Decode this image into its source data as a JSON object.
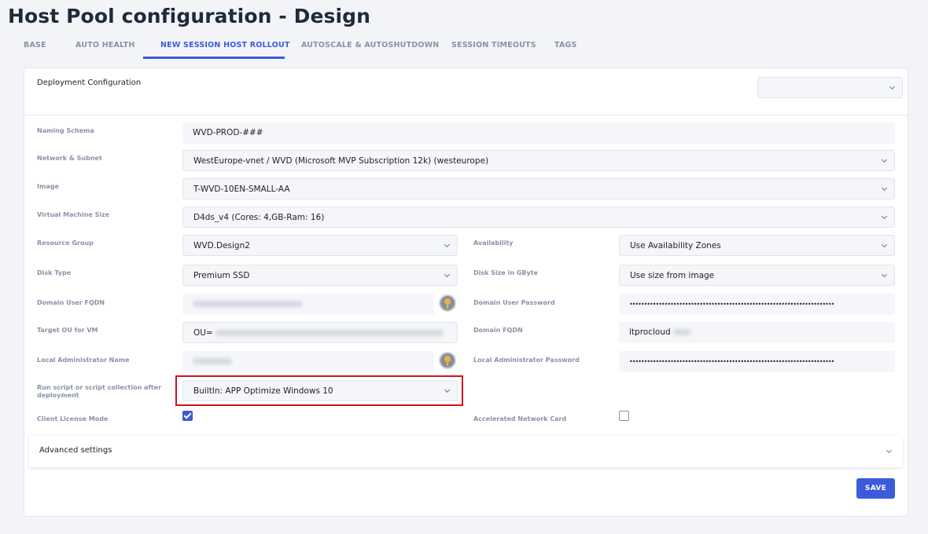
{
  "page_title": "Host Pool configuration - Design",
  "tabs": [
    {
      "label": "BASE"
    },
    {
      "label": "AUTO HEALTH"
    },
    {
      "label": "NEW SESSION HOST ROLLOUT",
      "active": true
    },
    {
      "label": "AUTOSCALE & AUTOSHUTDOWN"
    },
    {
      "label": "SESSION TIMEOUTS"
    },
    {
      "label": "TAGS"
    }
  ],
  "section": {
    "title": "Deployment Configuration",
    "config_select_value": ""
  },
  "fields": {
    "naming_schema": {
      "label": "Naming Schema",
      "value": "WVD-PROD-###"
    },
    "network_subnet": {
      "label": "Network & Subnet",
      "value": "WestEurope-vnet / WVD (Microsoft MVP Subscription 12k) (westeurope)"
    },
    "image": {
      "label": "Image",
      "value": "T-WVD-10EN-SMALL-AA"
    },
    "vm_size": {
      "label": "Virtual Machine Size",
      "value": "D4ds_v4 (Cores: 4,GB-Ram: 16)"
    },
    "resource_group": {
      "label": "Resource Group",
      "value": "WVD.Design2"
    },
    "availability": {
      "label": "Availability",
      "value": "Use Availability Zones"
    },
    "disk_type": {
      "label": "Disk Type",
      "value": "Premium SSD"
    },
    "disk_size": {
      "label": "Disk Size in GByte",
      "value": "Use size from image"
    },
    "domain_user_fqdn": {
      "label": "Domain User FQDN",
      "value": ""
    },
    "domain_user_password": {
      "label": "Domain User Password",
      "value": "••••••••••••••••••••••••••••••••••••••••••••••••••••••••••••••••••••••"
    },
    "target_ou": {
      "label": "Target OU for VM",
      "value": "OU="
    },
    "domain_fqdn": {
      "label": "Domain FQDN",
      "value": "itprocloud"
    },
    "local_admin_name": {
      "label": "Local Administrator Name",
      "value": ""
    },
    "local_admin_password": {
      "label": "Local Administrator Password",
      "value": "••••••••••••••••••••••••••••••••••••••••••••••••••••••••••••••••••••••"
    },
    "run_script": {
      "label_line1": "Run script or script collection after",
      "label_line2": "deployment",
      "value": "BuiltIn: APP Optimize Windows 10"
    },
    "client_license_mode": {
      "label": "Client License Mode",
      "checked": true
    },
    "accelerated_network": {
      "label": "Accelerated Network Card",
      "checked": false
    }
  },
  "advanced_settings": {
    "label": "Advanced settings"
  },
  "save_button": {
    "label": "SAVE"
  },
  "colors": {
    "accent": "#3b5bdb",
    "highlight_border": "#d0121b"
  },
  "icons": {
    "key": "key-icon",
    "chevron": "chevron-down-icon"
  }
}
